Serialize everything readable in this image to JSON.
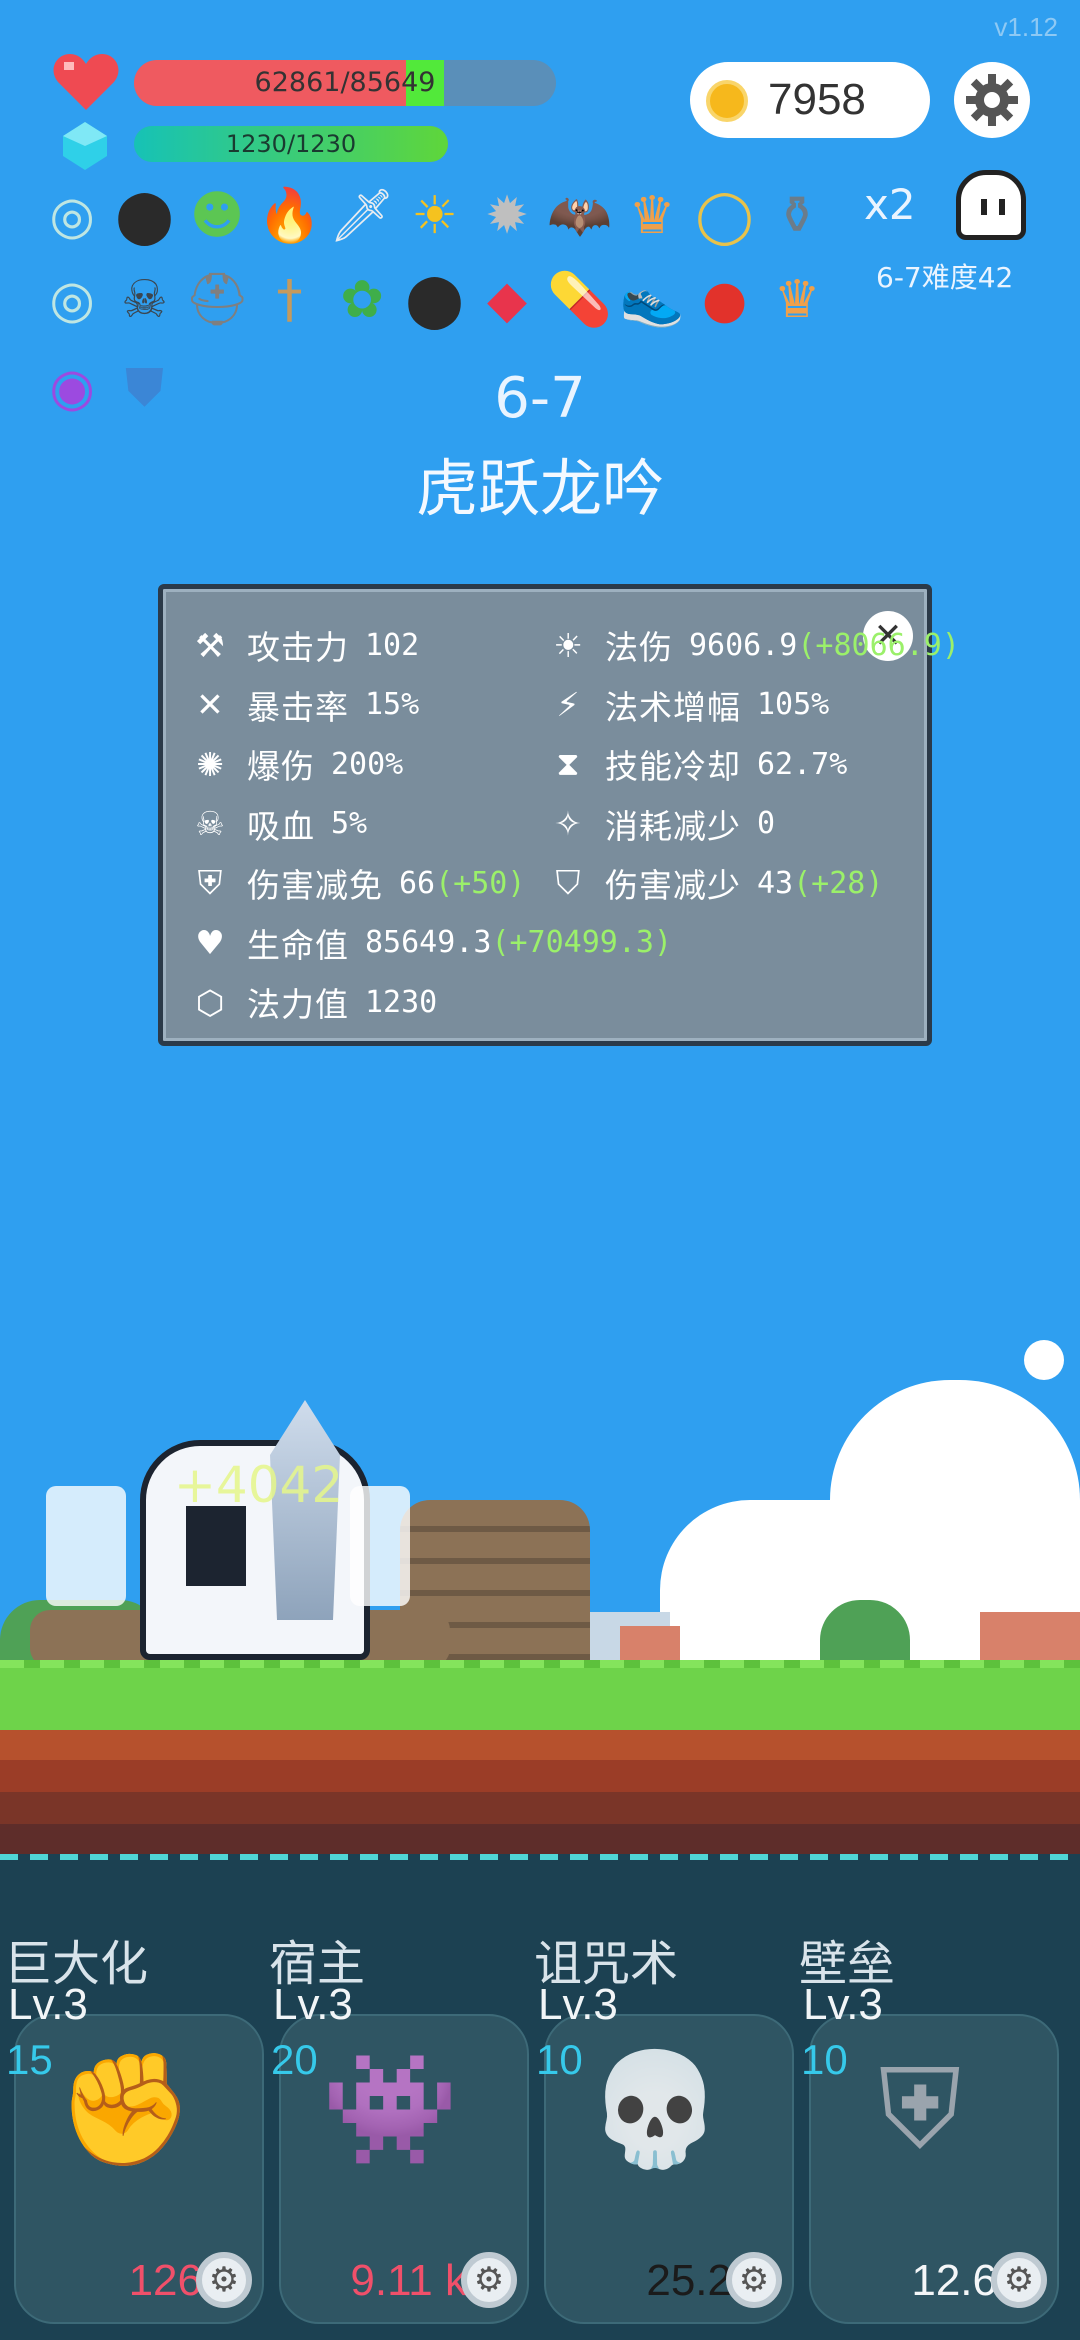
{
  "version": "v1.12",
  "player": {
    "hp_text": "62861/85649",
    "hp_fraction": 0.734,
    "hp_bonus_fraction": 0.09,
    "mp_text": "1230/1230",
    "mp_fraction": 1.0
  },
  "gold": "7958",
  "items_row1": [
    "target-disc",
    "black-cauldron",
    "green-monster",
    "fire",
    "sword",
    "sun-orb",
    "spiked-mace",
    "bat",
    "crown",
    "gold-ring",
    "mortar-pestle"
  ],
  "items_row2": [
    "target-disc",
    "skull-book",
    "spartan-helmet",
    "dagger",
    "potted-plant",
    "black-cauldron",
    "ruby-gem",
    "pill-capsule",
    "sneaker",
    "apple",
    "crown"
  ],
  "items_row3": [
    "crystal-ball",
    "blue-shield"
  ],
  "multiplier": "x2",
  "difficulty": "6-7难度42",
  "stage": {
    "number": "6-7",
    "name": "虎跃龙吟"
  },
  "stats_left": [
    {
      "icon": "axe-icon",
      "name": "攻击力",
      "value": "102",
      "bonus": ""
    },
    {
      "icon": "crit-icon",
      "name": "暴击率",
      "value": "15%",
      "bonus": ""
    },
    {
      "icon": "burst-icon",
      "name": "爆伤",
      "value": "200%",
      "bonus": ""
    },
    {
      "icon": "skull-horns-icon",
      "name": "吸血",
      "value": "5%",
      "bonus": ""
    },
    {
      "icon": "shield-icon",
      "name": "伤害减免",
      "value": "66",
      "bonus": "(+50)"
    },
    {
      "icon": "heart-icon",
      "name": "生命值",
      "value": "85649.3",
      "bonus": "(+70499.3)"
    },
    {
      "icon": "hexagon-icon",
      "name": "法力值",
      "value": "1230",
      "bonus": ""
    }
  ],
  "stats_right": [
    {
      "icon": "sun-icon",
      "name": "法伤",
      "value": "9606.9",
      "bonus": "(+8066.9)"
    },
    {
      "icon": "lightning-icon",
      "name": "法术增幅",
      "value": "105%",
      "bonus": ""
    },
    {
      "icon": "hourglass-icon",
      "name": "技能冷却",
      "value": "62.7%",
      "bonus": ""
    },
    {
      "icon": "magic-wand-icon",
      "name": "消耗减少",
      "value": "0",
      "bonus": ""
    },
    {
      "icon": "shield-fist-icon",
      "name": "伤害减少",
      "value": "43",
      "bonus": "(+28)"
    }
  ],
  "combat_text": "+4042",
  "skills": [
    {
      "name": "巨大化",
      "level": "Lv.3",
      "cost": "15",
      "value": "126",
      "value_color": "#f0506a",
      "art": "fist-icon"
    },
    {
      "name": "宿主",
      "level": "Lv.3",
      "cost": "20",
      "value": "9.11 k",
      "value_color": "#f0506a",
      "art": "green-monster-icon"
    },
    {
      "name": "诅咒术",
      "level": "Lv.3",
      "cost": "10",
      "value": "25.2",
      "value_color": "#1b1b1b",
      "art": "skull-icon"
    },
    {
      "name": "壁垒",
      "level": "Lv.3",
      "cost": "10",
      "value": "12.6",
      "value_color": "#f4f6f8",
      "art": "armor-icon"
    }
  ]
}
